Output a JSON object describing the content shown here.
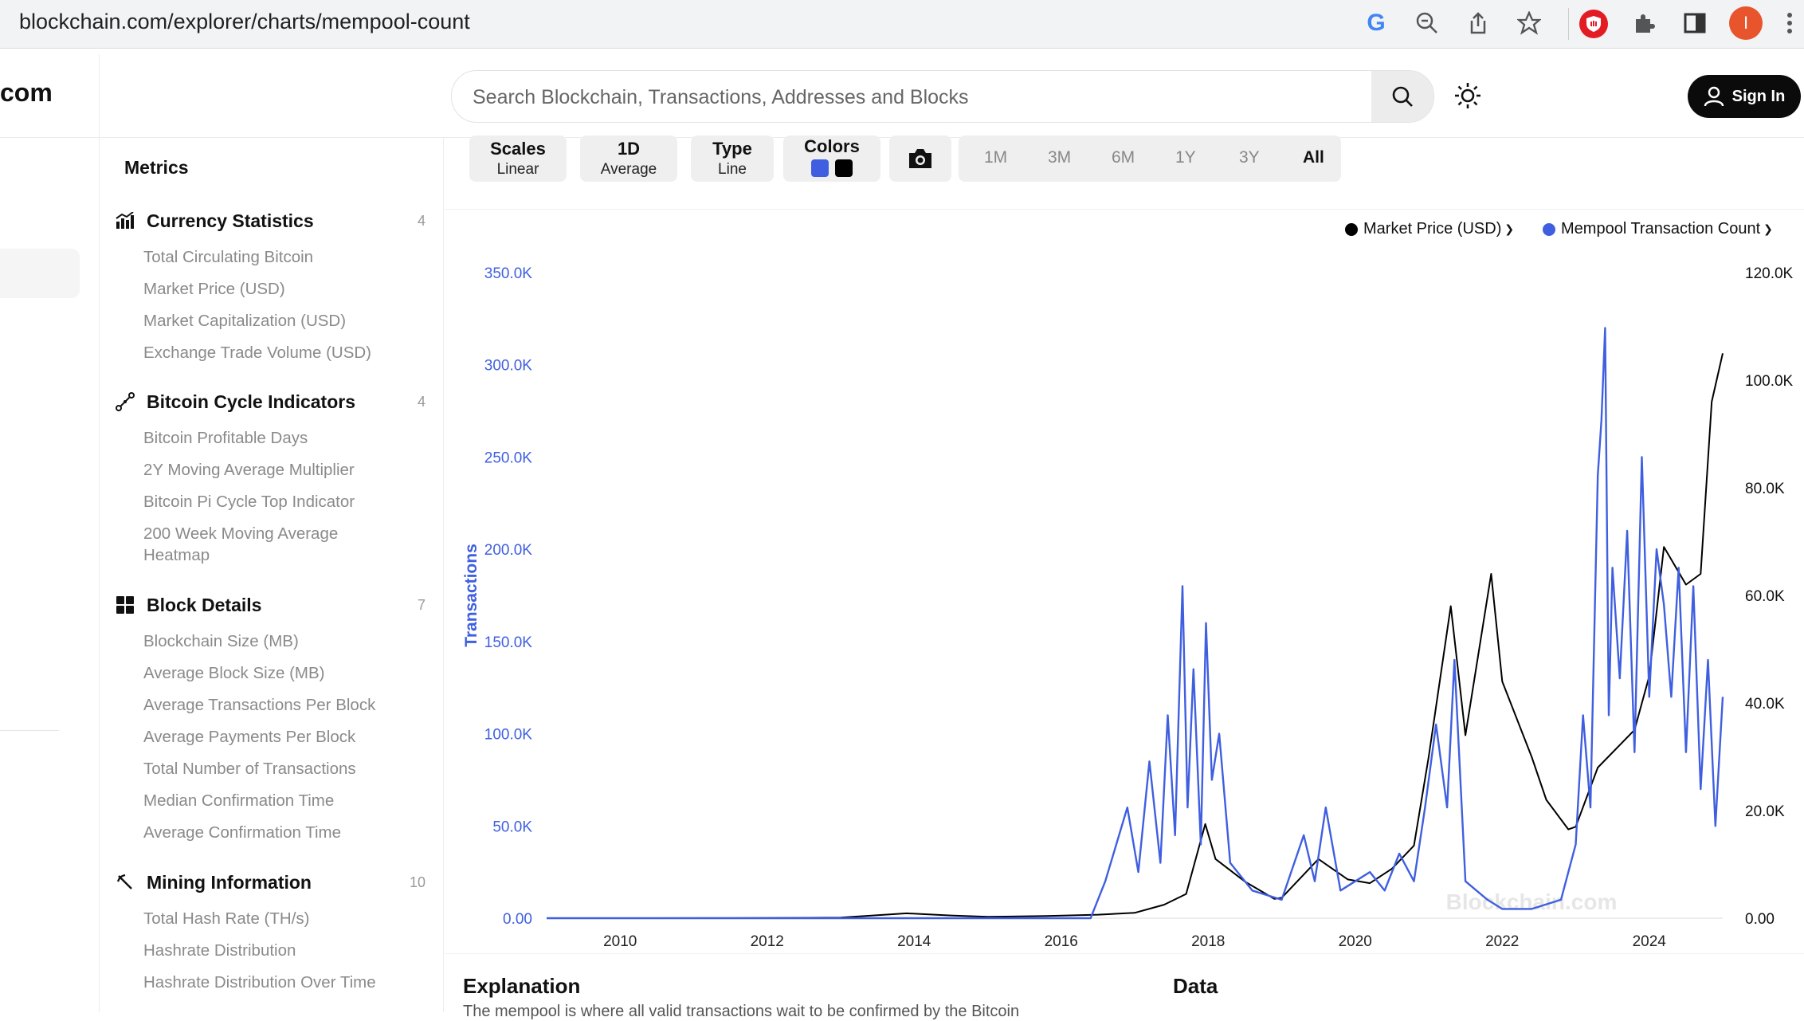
{
  "browser": {
    "url": "blockchain.com/explorer/charts/mempool-count",
    "profile_initial": "I"
  },
  "header": {
    "logo_text": "com",
    "search_placeholder": "Search Blockchain, Transactions, Addresses and Blocks",
    "sign_in_label": "Sign In"
  },
  "sidebar": {
    "title": "Metrics",
    "sections": [
      {
        "title": "Currency Statistics",
        "count": "4",
        "icon": "bar-chart-icon",
        "items": [
          "Total Circulating Bitcoin",
          "Market Price (USD)",
          "Market Capitalization (USD)",
          "Exchange Trade Volume (USD)"
        ]
      },
      {
        "title": "Bitcoin Cycle Indicators",
        "count": "4",
        "icon": "cycle-icon",
        "items": [
          "Bitcoin Profitable Days",
          "2Y Moving Average Multiplier",
          "Bitcoin Pi Cycle Top Indicator",
          "200 Week Moving Average Heatmap"
        ]
      },
      {
        "title": "Block Details",
        "count": "7",
        "icon": "grid-icon",
        "items": [
          "Blockchain Size (MB)",
          "Average Block Size (MB)",
          "Average Transactions Per Block",
          "Average Payments Per Block",
          "Total Number of Transactions",
          "Median Confirmation Time",
          "Average Confirmation Time"
        ]
      },
      {
        "title": "Mining Information",
        "count": "10",
        "icon": "pickaxe-icon",
        "items": [
          "Total Hash Rate (TH/s)",
          "Hashrate Distribution",
          "Hashrate Distribution Over Time"
        ]
      }
    ]
  },
  "toolbar": {
    "scales": {
      "label": "Scales",
      "value": "Linear"
    },
    "interval": {
      "label": "1D",
      "value": "Average"
    },
    "type": {
      "label": "Type",
      "value": "Line"
    },
    "colors": {
      "label": "Colors",
      "swatch1": "#3f5fe0",
      "swatch2": "#000000"
    },
    "ranges": [
      "1M",
      "3M",
      "6M",
      "1Y",
      "3Y",
      "All"
    ],
    "active_range": "All"
  },
  "chart_data": {
    "type": "line",
    "title": "",
    "legend_placement": "top-right",
    "grid": false,
    "x_ticks": [
      "2010",
      "2012",
      "2014",
      "2016",
      "2018",
      "2020",
      "2022",
      "2024"
    ],
    "xlim": [
      2009.0,
      2025.0
    ],
    "y_left": {
      "label": "Transactions",
      "ticks": [
        "0.00",
        "50.0K",
        "100.0K",
        "150.0K",
        "200.0K",
        "250.0K",
        "300.0K",
        "350.0K"
      ],
      "lim": [
        0,
        350000
      ],
      "color": "#3f5fe0"
    },
    "y_right": {
      "label": "",
      "ticks": [
        "0.00",
        "20.0K",
        "40.0K",
        "60.0K",
        "80.0K",
        "100.0K",
        "120.0K"
      ],
      "lim": [
        0,
        120000
      ],
      "color": "#111111"
    },
    "watermark": "Blockchain.com",
    "series": [
      {
        "name": "Market Price (USD)",
        "axis": "right",
        "color": "#000000",
        "x": [
          2009.0,
          2010.5,
          2011.5,
          2013.0,
          2013.9,
          2014.5,
          2015.0,
          2015.8,
          2016.5,
          2017.0,
          2017.4,
          2017.7,
          2017.96,
          2018.1,
          2018.5,
          2018.9,
          2019.0,
          2019.5,
          2019.9,
          2020.2,
          2020.5,
          2020.8,
          2021.0,
          2021.3,
          2021.5,
          2021.85,
          2022.0,
          2022.4,
          2022.6,
          2022.9,
          2023.0,
          2023.3,
          2023.8,
          2024.0,
          2024.2,
          2024.5,
          2024.7,
          2024.85,
          2025.0
        ],
        "y": [
          0,
          0,
          10,
          100,
          900,
          500,
          250,
          400,
          650,
          1000,
          2500,
          4500,
          17500,
          11000,
          6800,
          3600,
          3800,
          11000,
          7200,
          6500,
          9200,
          13500,
          30000,
          58000,
          34000,
          64000,
          44000,
          30000,
          22000,
          16500,
          17000,
          28000,
          35000,
          45000,
          69000,
          62000,
          64000,
          96000,
          105000
        ]
      },
      {
        "name": "Mempool Transaction Count",
        "axis": "left",
        "color": "#3f5fe0",
        "x": [
          2009.0,
          2016.4,
          2016.6,
          2016.9,
          2017.05,
          2017.2,
          2017.35,
          2017.45,
          2017.55,
          2017.65,
          2017.72,
          2017.8,
          2017.9,
          2017.97,
          2018.05,
          2018.15,
          2018.3,
          2018.6,
          2019.0,
          2019.3,
          2019.45,
          2019.6,
          2019.8,
          2020.0,
          2020.2,
          2020.4,
          2020.6,
          2020.8,
          2020.95,
          2021.1,
          2021.25,
          2021.35,
          2021.5,
          2021.8,
          2022.0,
          2022.4,
          2022.8,
          2023.0,
          2023.1,
          2023.2,
          2023.3,
          2023.35,
          2023.4,
          2023.45,
          2023.5,
          2023.6,
          2023.7,
          2023.8,
          2023.9,
          2024.0,
          2024.1,
          2024.2,
          2024.3,
          2024.4,
          2024.5,
          2024.6,
          2024.7,
          2024.8,
          2024.9,
          2025.0
        ],
        "y": [
          0,
          0,
          20000,
          60000,
          25000,
          85000,
          30000,
          110000,
          45000,
          180000,
          60000,
          135000,
          40000,
          160000,
          75000,
          100000,
          30000,
          15000,
          10000,
          45000,
          20000,
          60000,
          15000,
          20000,
          25000,
          15000,
          35000,
          20000,
          60000,
          105000,
          60000,
          140000,
          20000,
          10000,
          5000,
          5000,
          10000,
          40000,
          110000,
          60000,
          240000,
          270000,
          320000,
          110000,
          190000,
          130000,
          210000,
          90000,
          250000,
          120000,
          200000,
          170000,
          120000,
          190000,
          90000,
          180000,
          70000,
          140000,
          50000,
          120000
        ]
      }
    ]
  },
  "bottom": {
    "explanation_title": "Explanation",
    "data_title": "Data",
    "explanation_text": "The mempool is where all valid transactions wait to be confirmed by the Bitcoin"
  }
}
